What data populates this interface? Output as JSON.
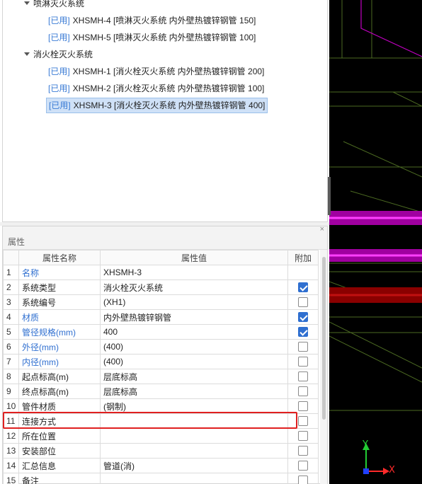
{
  "tree": {
    "groups": [
      {
        "label": "喷淋灭火系统"
      },
      {
        "label": "消火栓灭火系统"
      }
    ],
    "leaves": [
      {
        "tag": "[已用]",
        "text": "XHSMH-4 [喷淋灭火系统 内外壁热镀锌钢管 150]"
      },
      {
        "tag": "[已用]",
        "text": "XHSMH-5 [喷淋灭火系统 内外壁热镀锌钢管 100]"
      },
      {
        "tag": "[已用]",
        "text": "XHSMH-1 [消火栓灭火系统 内外壁热镀锌钢管 200]"
      },
      {
        "tag": "[已用]",
        "text": "XHSMH-2 [消火栓灭火系统 内外壁热镀锌钢管 100]"
      },
      {
        "tag": "[已用]",
        "text": "XHSMH-3 [消火栓灭火系统 内外壁热镀锌钢管 400]"
      }
    ],
    "selected_index": 4
  },
  "properties": {
    "title": "属性",
    "close_label": "×",
    "headers": {
      "index": "",
      "name": "属性名称",
      "value": "属性值",
      "extra": "附加"
    },
    "rows": [
      {
        "idx": "1",
        "name": "名称",
        "value": "XHSMH-3",
        "blue": true,
        "checkbox": "none"
      },
      {
        "idx": "2",
        "name": "系统类型",
        "value": "消火栓灭火系统",
        "blue": false,
        "checkbox": "on"
      },
      {
        "idx": "3",
        "name": "系统编号",
        "value": "(XH1)",
        "blue": false,
        "checkbox": "off"
      },
      {
        "idx": "4",
        "name": "材质",
        "value": "内外壁热镀锌钢管",
        "blue": true,
        "checkbox": "on"
      },
      {
        "idx": "5",
        "name": "管径规格(mm)",
        "value": "400",
        "blue": true,
        "checkbox": "on"
      },
      {
        "idx": "6",
        "name": "外径(mm)",
        "value": "(400)",
        "blue": true,
        "checkbox": "off"
      },
      {
        "idx": "7",
        "name": "内径(mm)",
        "value": "(400)",
        "blue": true,
        "checkbox": "off"
      },
      {
        "idx": "8",
        "name": "起点标高(m)",
        "value": "层底标高",
        "blue": false,
        "checkbox": "off"
      },
      {
        "idx": "9",
        "name": "终点标高(m)",
        "value": "层底标高",
        "blue": false,
        "checkbox": "off"
      },
      {
        "idx": "10",
        "name": "管件材质",
        "value": "(钢制)",
        "blue": false,
        "checkbox": "off"
      },
      {
        "idx": "11",
        "name": "连接方式",
        "value": "",
        "blue": false,
        "checkbox": "off"
      },
      {
        "idx": "12",
        "name": "所在位置",
        "value": "",
        "blue": false,
        "checkbox": "off"
      },
      {
        "idx": "13",
        "name": "安装部位",
        "value": "",
        "blue": false,
        "checkbox": "off"
      },
      {
        "idx": "14",
        "name": "汇总信息",
        "value": "管道(消)",
        "blue": false,
        "checkbox": "off"
      },
      {
        "idx": "15",
        "name": "备注",
        "value": "",
        "blue": false,
        "checkbox": "off"
      }
    ]
  },
  "viewport": {
    "axis_x_label": "X",
    "axis_y_label": "Y",
    "colors": {
      "magenta": "#c000c0",
      "red": "#b00000",
      "green": "#5a7a2a",
      "axis_x": "#ff2a2a",
      "axis_y": "#22cc33"
    }
  }
}
